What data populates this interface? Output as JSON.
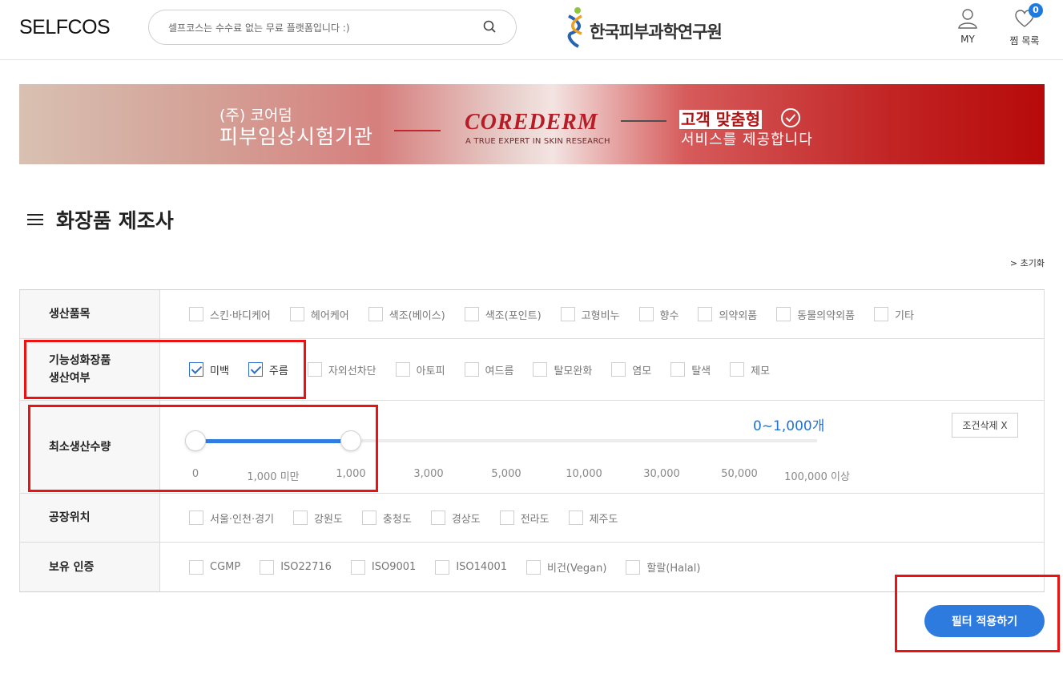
{
  "header": {
    "logo": "SELFCOS",
    "search_placeholder": "셀프코스는 수수료 없는 무료 플랫폼입니다 :)",
    "partner_name": "한국피부과학연구원",
    "my_label": "MY",
    "wishlist_label": "찜 목록",
    "wishlist_count": "0"
  },
  "banner": {
    "line1": "(주) 코어덤",
    "line2": "피부임상시험기관",
    "brand": "COREDERM",
    "brand_sub": "A TRUE EXPERT IN SKIN RESEARCH",
    "tagline_highlight": "고객 맞춤형",
    "tagline2": "서비스를 제공합니다"
  },
  "page": {
    "title": "화장품 제조사",
    "reset_link": "> 초기화",
    "apply_button": "필터 적용하기"
  },
  "filters": {
    "product_category": {
      "label": "생산품목",
      "options": [
        "스킨·바디케어",
        "헤어케어",
        "색조(베이스)",
        "색조(포인트)",
        "고형비누",
        "향수",
        "의약외품",
        "동물의약외품",
        "기타"
      ]
    },
    "functional": {
      "label_line1": "기능성화장품",
      "label_line2": "생산여부",
      "options": [
        "미백",
        "주름",
        "자외선차단",
        "아토피",
        "여드름",
        "탈모완화",
        "염모",
        "탈색",
        "제모"
      ],
      "checked": [
        "미백",
        "주름"
      ]
    },
    "min_quantity": {
      "label": "최소생산수량",
      "range_text": "0~1,000개",
      "clear_button": "조건삭제 X",
      "ticks": [
        "0",
        "1,000 미만",
        "1,000",
        "3,000",
        "5,000",
        "10,000",
        "30,000",
        "50,000",
        "100,000 이상"
      ],
      "selected_min": "0",
      "selected_max": "1,000"
    },
    "factory_location": {
      "label": "공장위치",
      "options": [
        "서울·인천·경기",
        "강원도",
        "충청도",
        "경상도",
        "전라도",
        "제주도"
      ]
    },
    "certification": {
      "label": "보유 인증",
      "options": [
        "CGMP",
        "ISO22716",
        "ISO9001",
        "ISO14001",
        "비건(Vegan)",
        "할랄(Halal)"
      ]
    }
  },
  "colors": {
    "accent": "#2e7be0",
    "highlight_box": "#ee1111"
  }
}
